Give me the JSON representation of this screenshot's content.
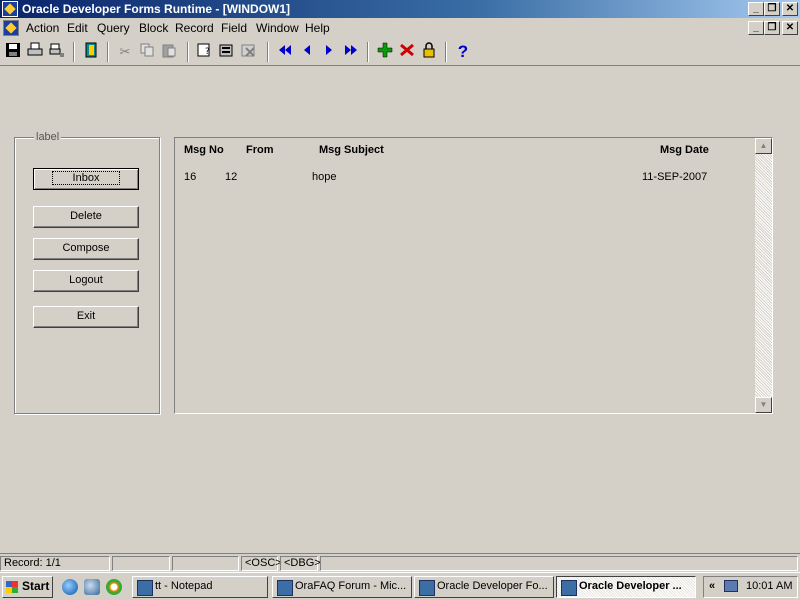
{
  "window": {
    "title": "Oracle Developer Forms Runtime - [WINDOW1]",
    "min": "_",
    "restore": "❐",
    "close": "✕"
  },
  "menu": [
    "Action",
    "Edit",
    "Query",
    "Block",
    "Record",
    "Field",
    "Window",
    "Help"
  ],
  "toolbar": {
    "icons": [
      "save-icon",
      "print-icon",
      "print-setup-icon",
      "exit-icon",
      "cut-icon",
      "copy-icon",
      "paste-icon",
      "enter-query-icon",
      "execute-query-icon",
      "cancel-query-icon",
      "first-record-icon",
      "previous-record-icon",
      "next-record-icon",
      "last-record-icon",
      "insert-record-icon",
      "delete-record-icon",
      "lock-record-icon",
      "help-icon"
    ],
    "glyphs": {
      "help": "?"
    }
  },
  "frame": {
    "label": "label",
    "buttons": [
      "Inbox",
      "Delete",
      "Compose",
      "Logout",
      "Exit"
    ]
  },
  "messages": {
    "headers": [
      "Msg No",
      "From",
      "Msg Subject",
      "Msg Date"
    ],
    "rows": [
      {
        "msg_no": "16",
        "from": "12",
        "subject": "hope",
        "date": "11-SEP-2007"
      }
    ]
  },
  "status": {
    "record": "Record: 1/1",
    "osc": "<OSC>",
    "dbg": "<DBG>"
  },
  "taskbar": {
    "start": "Start",
    "tasks": [
      "tt - Notepad",
      "OraFAQ Forum - Mic...",
      "Oracle Developer Fo...",
      "Oracle Developer ..."
    ],
    "clock": "10:01 AM",
    "chevron": "«"
  }
}
